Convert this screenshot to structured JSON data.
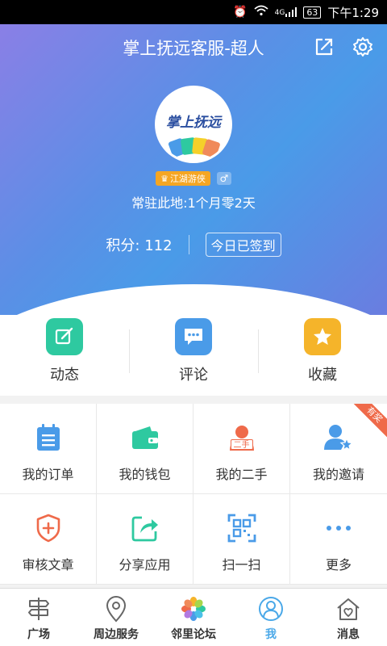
{
  "status_bar": {
    "network": "4G",
    "battery": "63",
    "time": "下午1:29"
  },
  "header": {
    "title": "掌上抚远客服-超人"
  },
  "profile": {
    "avatar_text": "掌上抚远",
    "level_badge": "江湖游侠",
    "gender_symbol": "♂",
    "resident_text": "常驻此地:1个月零2天",
    "points_label": "积分: 112",
    "checkin_label": "今日已签到"
  },
  "quick_actions": [
    {
      "label": "动态",
      "icon": "edit-icon",
      "color": "#2ec9a0"
    },
    {
      "label": "评论",
      "icon": "comment-icon",
      "color": "#4a9be8"
    },
    {
      "label": "收藏",
      "icon": "star-icon",
      "color": "#f5b42a"
    }
  ],
  "grid_items": [
    {
      "label": "我的订单",
      "icon": "order-icon"
    },
    {
      "label": "我的钱包",
      "icon": "wallet-icon"
    },
    {
      "label": "我的二手",
      "icon": "secondhand-icon",
      "icon_text": "二手"
    },
    {
      "label": "我的邀请",
      "icon": "invite-icon",
      "ribbon": "有奖"
    },
    {
      "label": "审核文章",
      "icon": "review-icon"
    },
    {
      "label": "分享应用",
      "icon": "share-app-icon"
    },
    {
      "label": "扫一扫",
      "icon": "scan-icon"
    },
    {
      "label": "更多",
      "icon": "more-icon"
    }
  ],
  "tabs": [
    {
      "label": "广场",
      "icon": "signpost-icon"
    },
    {
      "label": "周边服务",
      "icon": "location-icon"
    },
    {
      "label": "邻里论坛",
      "icon": "flower-icon"
    },
    {
      "label": "我",
      "icon": "user-icon",
      "active": true
    },
    {
      "label": "消息",
      "icon": "house-message-icon"
    }
  ],
  "colors": {
    "accent": "#4aa8e8",
    "ribbon": "#ef6a4a",
    "badge": "#f5a623"
  }
}
